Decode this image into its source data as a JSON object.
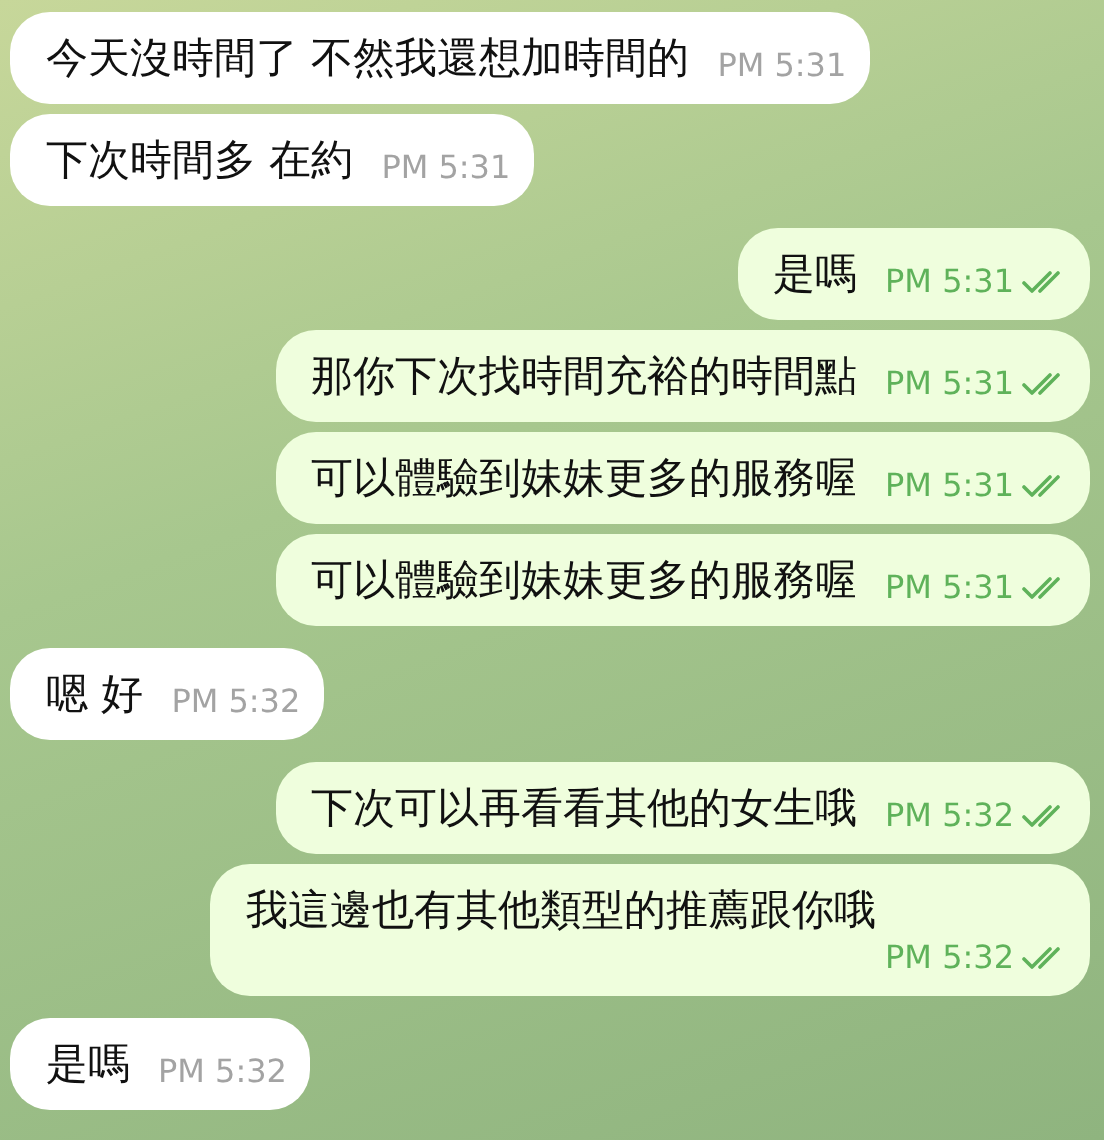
{
  "messages": [
    {
      "kind": "incoming",
      "text": "今天沒時間了 不然我還想加時間的",
      "time": "PM 5:31"
    },
    {
      "kind": "incoming",
      "text": "下次時間多 在約",
      "time": "PM 5:31"
    },
    {
      "kind": "outgoing",
      "text": "是嗎",
      "time": "PM 5:31",
      "read": true
    },
    {
      "kind": "outgoing",
      "text": "那你下次找時間充裕的時間點",
      "time": "PM 5:31",
      "read": true
    },
    {
      "kind": "outgoing",
      "text": "可以體驗到妹妹更多的服務喔",
      "time": "PM 5:31",
      "read": true
    },
    {
      "kind": "outgoing",
      "text": "可以體驗到妹妹更多的服務喔",
      "time": "PM 5:31",
      "read": true
    },
    {
      "kind": "incoming",
      "text": "嗯 好",
      "time": "PM 5:32"
    },
    {
      "kind": "outgoing",
      "text": "下次可以再看看其他的女生哦",
      "time": "PM 5:32",
      "read": true
    },
    {
      "kind": "outgoing",
      "text": "我這邊也有其他類型的推薦跟你哦",
      "time": "PM 5:32",
      "read": true
    },
    {
      "kind": "incoming",
      "text": "是嗎",
      "time": "PM 5:32"
    }
  ]
}
